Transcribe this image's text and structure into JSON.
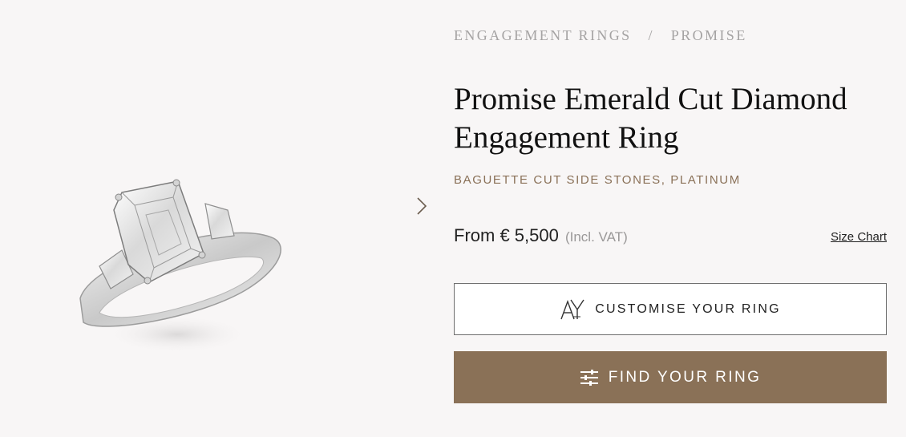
{
  "breadcrumb": {
    "items": [
      "ENGAGEMENT RINGS",
      "PROMISE"
    ],
    "separator": "/"
  },
  "product": {
    "title": "Promise Emerald Cut Diamond Engagement Ring",
    "subtitle": "BAGUETTE CUT SIDE STONES, PLATINUM",
    "price": "From € 5,500",
    "vat_note": "(Incl. VAT)",
    "size_chart_label": "Size Chart"
  },
  "buttons": {
    "customise_label": "CUSTOMISE YOUR RING",
    "customise_icon": "engraving-letters-icon",
    "find_label": "FIND YOUR RING",
    "find_icon": "sliders-icon"
  },
  "gallery": {
    "next_icon": "chevron-right-icon"
  },
  "colors": {
    "background": "#f8f6f6",
    "accent": "#8a7157",
    "breadcrumb": "#a5a3a3"
  }
}
